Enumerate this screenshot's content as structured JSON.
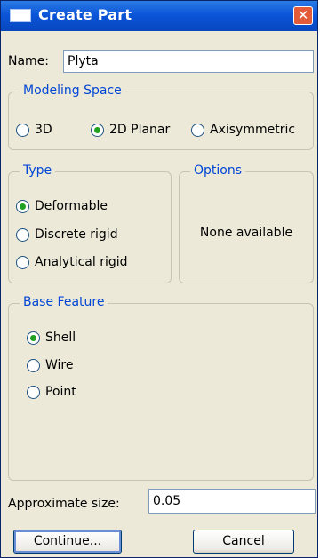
{
  "window": {
    "title": "Create Part",
    "title_icon": "window-icon",
    "close_icon": "close-icon"
  },
  "name_field": {
    "label": "Name:",
    "value": "Plyta"
  },
  "modeling_space": {
    "title": "Modeling Space",
    "options": [
      {
        "label": "3D",
        "checked": false
      },
      {
        "label": "2D Planar",
        "checked": true
      },
      {
        "label": "Axisymmetric",
        "checked": false
      }
    ]
  },
  "type": {
    "title": "Type",
    "options": [
      {
        "label": "Deformable",
        "checked": true
      },
      {
        "label": "Discrete rigid",
        "checked": false
      },
      {
        "label": "Analytical rigid",
        "checked": false
      }
    ]
  },
  "options_panel": {
    "title": "Options",
    "text": "None available"
  },
  "base_feature": {
    "title": "Base Feature",
    "options": [
      {
        "label": "Shell",
        "checked": true
      },
      {
        "label": "Wire",
        "checked": false
      },
      {
        "label": "Point",
        "checked": false
      }
    ]
  },
  "approx_size": {
    "label": "Approximate size:",
    "value": "0.05"
  },
  "buttons": {
    "continue": "Continue...",
    "cancel": "Cancel"
  },
  "colors": {
    "titlebar": "#0b55d9",
    "group_title": "#0046d5",
    "radio_dot": "#21a121",
    "window_bg": "#ece9d8"
  }
}
